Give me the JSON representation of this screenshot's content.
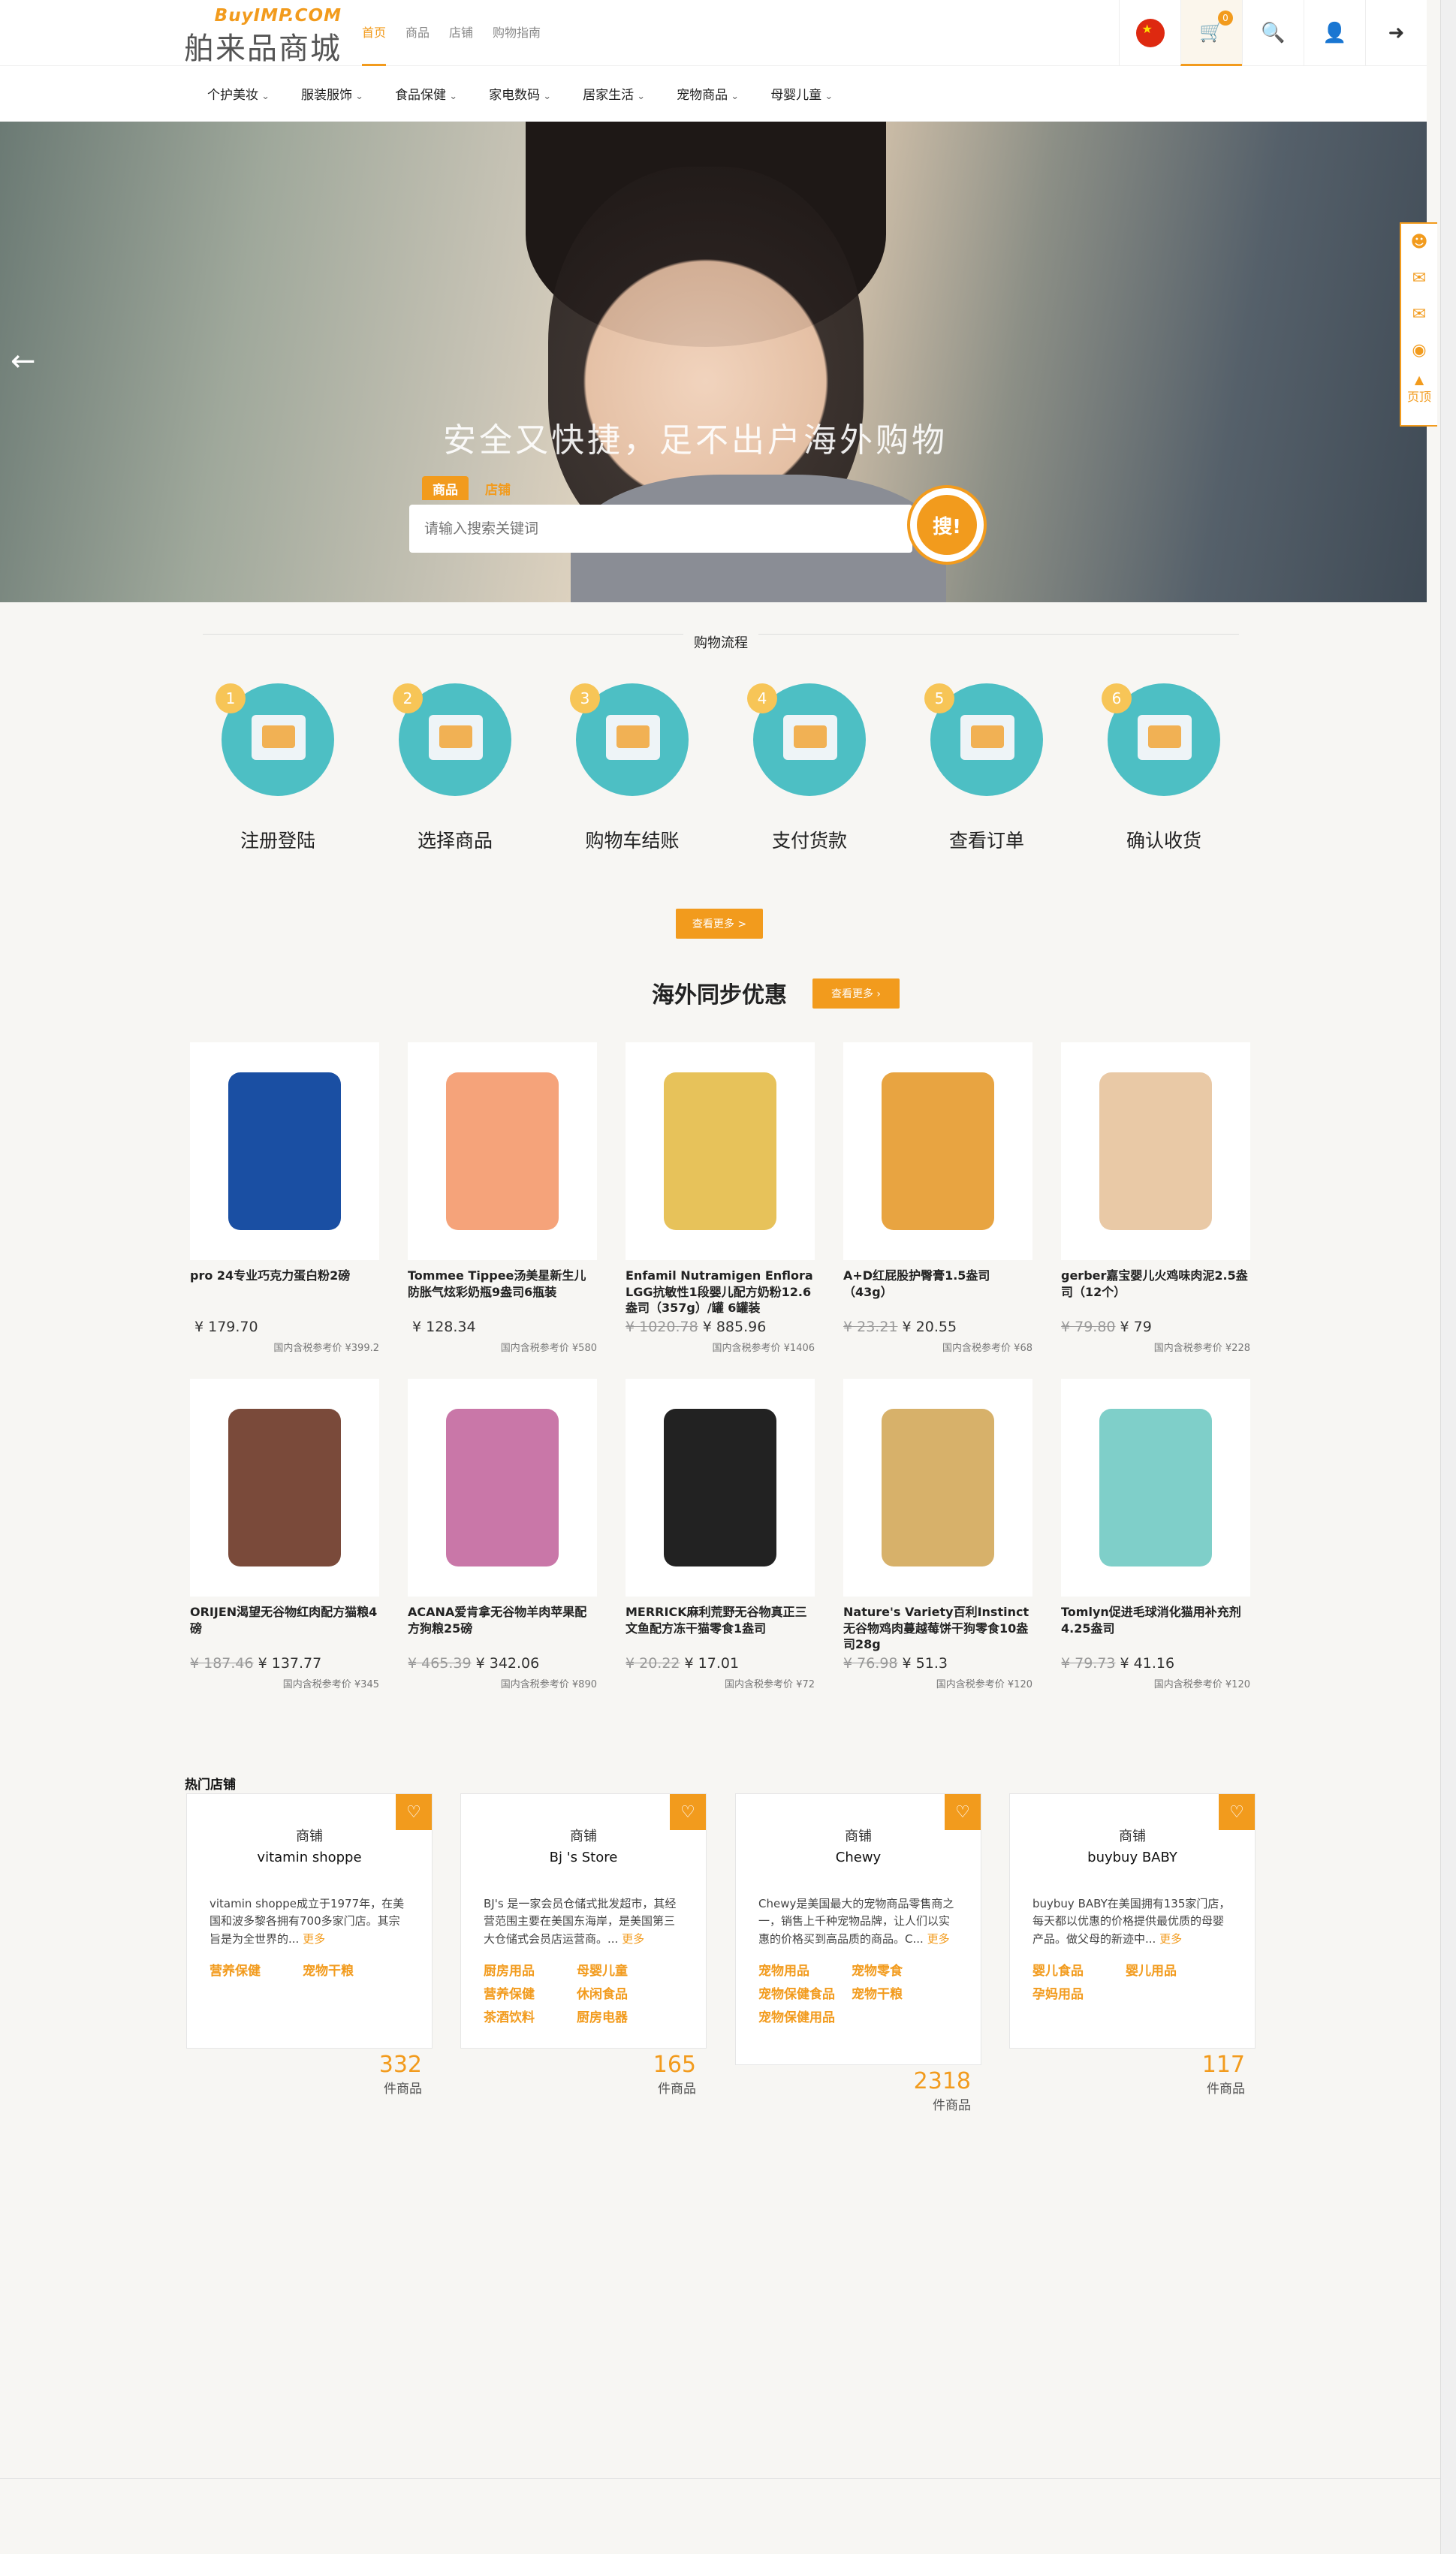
{
  "header": {
    "logo_top": "BuyIMP.COM",
    "logo_main": "舶来品商城",
    "nav": [
      "首页",
      "商品",
      "店铺",
      "购物指南"
    ],
    "cart_count": "0"
  },
  "categories": [
    "个护美妆",
    "服装服饰",
    "食品保健",
    "家电数码",
    "居家生活",
    "宠物商品",
    "母婴儿童"
  ],
  "hero": {
    "slogan": "安全又快捷，足不出户海外购物",
    "tabs": [
      "商品",
      "店铺"
    ],
    "placeholder": "请输入搜索关键词",
    "search_label": "搜!"
  },
  "side": {
    "top_label": "页顶"
  },
  "process": {
    "title": "购物流程",
    "steps": [
      {
        "num": "1",
        "label": "注册登陆"
      },
      {
        "num": "2",
        "label": "选择商品"
      },
      {
        "num": "3",
        "label": "购物车结账"
      },
      {
        "num": "4",
        "label": "支付货款"
      },
      {
        "num": "5",
        "label": "查看订单"
      },
      {
        "num": "6",
        "label": "确认收货"
      }
    ],
    "more": "查看更多 >"
  },
  "deals": {
    "title": "海外同步优惠",
    "more": "查看更多  ›",
    "products": [
      {
        "name": "pro 24专业巧克力蛋白粉2磅",
        "old": "",
        "price": "¥ 179.70",
        "ref": "国内含税参考价 ¥399.2",
        "color": "#1a4fa3"
      },
      {
        "name": "Tommee Tippee汤美星新生儿防胀气炫彩奶瓶9盎司6瓶装",
        "old": "",
        "price": "¥ 128.34",
        "ref": "国内含税参考价 ¥580",
        "color": "#f5a37a"
      },
      {
        "name": "Enfamil Nutramigen Enflora LGG抗敏性1段婴儿配方奶粉12.6盎司（357g）/罐 6罐装",
        "old": "¥ 1020.78",
        "price": "¥ 885.96",
        "ref": "国内含税参考价 ¥1406",
        "color": "#e7c25a"
      },
      {
        "name": "A+D红屁股护臀膏1.5盎司（43g）",
        "old": "¥ 23.21",
        "price": "¥ 20.55",
        "ref": "国内含税参考价 ¥68",
        "color": "#e8a441"
      },
      {
        "name": "gerber嘉宝婴儿火鸡味肉泥2.5盎司（12个）",
        "old": "¥ 79.80",
        "price": "¥ 79",
        "ref": "国内含税参考价 ¥228",
        "color": "#e9c9a6"
      },
      {
        "name": "ORIJEN渴望无谷物红肉配方猫粮4磅",
        "old": "¥ 187.46",
        "price": "¥ 137.77",
        "ref": "国内含税参考价 ¥345",
        "color": "#7a4a3a"
      },
      {
        "name": "ACANA爱肯拿无谷物羊肉苹果配方狗粮25磅",
        "old": "¥ 465.39",
        "price": "¥ 342.06",
        "ref": "国内含税参考价 ¥890",
        "color": "#c977a8"
      },
      {
        "name": "MERRICK麻利荒野无谷物真正三文鱼配方冻干猫零食1盎司",
        "old": "¥ 20.22",
        "price": "¥ 17.01",
        "ref": "国内含税参考价 ¥72",
        "color": "#222222"
      },
      {
        "name": "Nature's Variety百利Instinct无谷物鸡肉蔓越莓饼干狗零食10盎司28g",
        "old": "¥ 76.98",
        "price": "¥ 51.3",
        "ref": "国内含税参考价 ¥120",
        "color": "#d7b16a"
      },
      {
        "name": "Tomlyn促进毛球消化猫用补充剂4.25盎司",
        "old": "¥ 79.73",
        "price": "¥ 41.16",
        "ref": "国内含税参考价 ¥120",
        "color": "#7fcfc9"
      }
    ]
  },
  "shops": {
    "title": "热门店铺",
    "label": "商铺",
    "unit": "件商品",
    "more": "更多",
    "items": [
      {
        "name": "vitamin shoppe",
        "desc": "vitamin shoppe成立于1977年，在美国和波多黎各拥有700多家门店。其宗旨是为全世界的...",
        "tags": [
          "营养保健",
          "宠物干粮"
        ],
        "count": "332"
      },
      {
        "name": "Bj  's Store",
        "desc": "BJ's 是一家会员仓储式批发超市，其经营范围主要在美国东海岸，是美国第三大仓储式会员店运营商。...",
        "tags": [
          "厨房用品",
          "母婴儿童",
          "营养保健",
          "休闲食品",
          "茶酒饮料",
          "厨房电器"
        ],
        "count": "165"
      },
      {
        "name": "Chewy",
        "desc": "Chewy是美国最大的宠物商品零售商之一，销售上千种宠物品牌，让人们以实惠的价格买到高品质的商品。C...",
        "tags": [
          "宠物用品",
          "宠物零食",
          "宠物保健食品",
          "宠物干粮",
          "宠物保健用品"
        ],
        "count": "2318"
      },
      {
        "name": "buybuy BABY",
        "desc": "buybuy BABY在美国拥有135家门店，每天都以优惠的价格提供最优质的母婴产品。做父母的新迹中...",
        "tags": [
          "婴儿食品",
          "婴儿用品",
          "孕妈用品"
        ],
        "count": "117"
      }
    ]
  }
}
